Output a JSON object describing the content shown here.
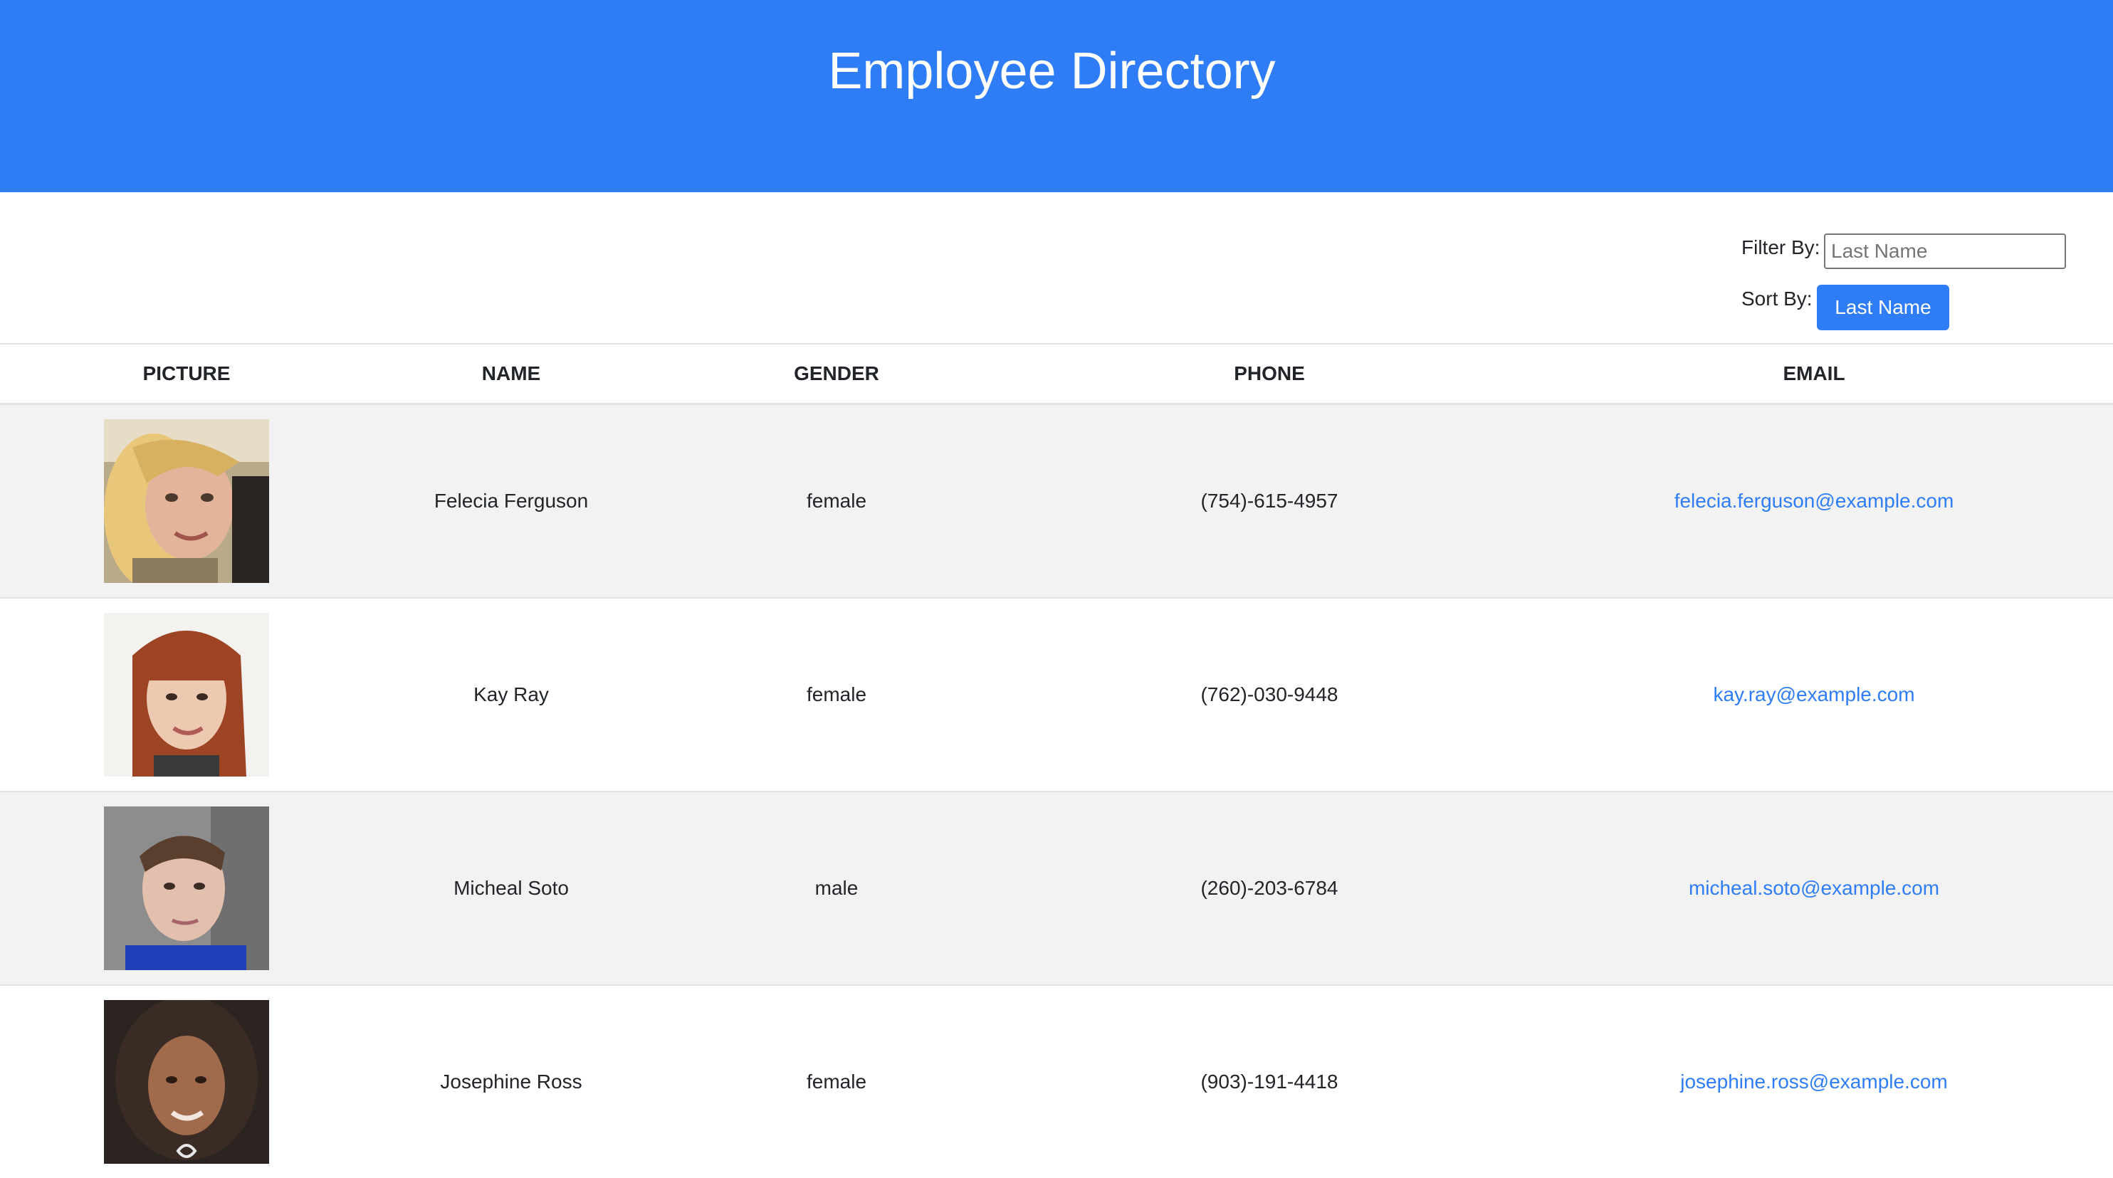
{
  "header": {
    "title": "Employee Directory"
  },
  "controls": {
    "filter_label": "Filter By:",
    "filter_placeholder": "Last Name",
    "filter_value": "",
    "sort_label": "Sort By:",
    "sort_button_label": "Last Name"
  },
  "table": {
    "headers": [
      "PICTURE",
      "NAME",
      "GENDER",
      "PHONE",
      "EMAIL"
    ],
    "rows": [
      {
        "name": "Felecia Ferguson",
        "gender": "female",
        "phone": "(754)-615-4957",
        "email": "felecia.ferguson@example.com"
      },
      {
        "name": "Kay Ray",
        "gender": "female",
        "phone": "(762)-030-9448",
        "email": "kay.ray@example.com"
      },
      {
        "name": "Micheal Soto",
        "gender": "male",
        "phone": "(260)-203-6784",
        "email": "micheal.soto@example.com"
      },
      {
        "name": "Josephine Ross",
        "gender": "female",
        "phone": "(903)-191-4418",
        "email": "josephine.ross@example.com"
      }
    ]
  },
  "colors": {
    "accent": "#2f7df6",
    "row_striped": "#f2f2f2",
    "border": "#dee2e6"
  }
}
